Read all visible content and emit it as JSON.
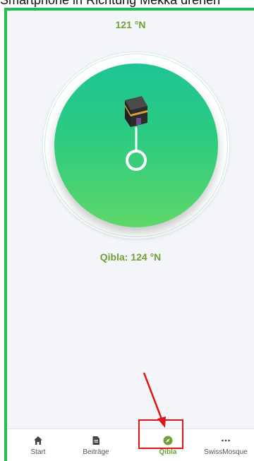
{
  "caption": "Smartphone in Richtung Mekka drehen",
  "compass": {
    "heading": "121 °N",
    "qibla_label": "Qibla: 124 °N",
    "kaaba": "kaaba-icon"
  },
  "tabbar": {
    "items": [
      {
        "label": "Start",
        "icon": "home-icon"
      },
      {
        "label": "Beiträge",
        "icon": "document-icon"
      },
      {
        "label": "Qibla",
        "icon": "compass-icon"
      },
      {
        "label": "SwissMosque",
        "icon": "more-icon"
      }
    ],
    "active": "Qibla"
  },
  "colors": {
    "accent": "#6fa136",
    "frame": "#1fbf50",
    "dial_top": "#1ec495",
    "dial_bottom": "#5fd769",
    "annotation": "#e01515"
  }
}
